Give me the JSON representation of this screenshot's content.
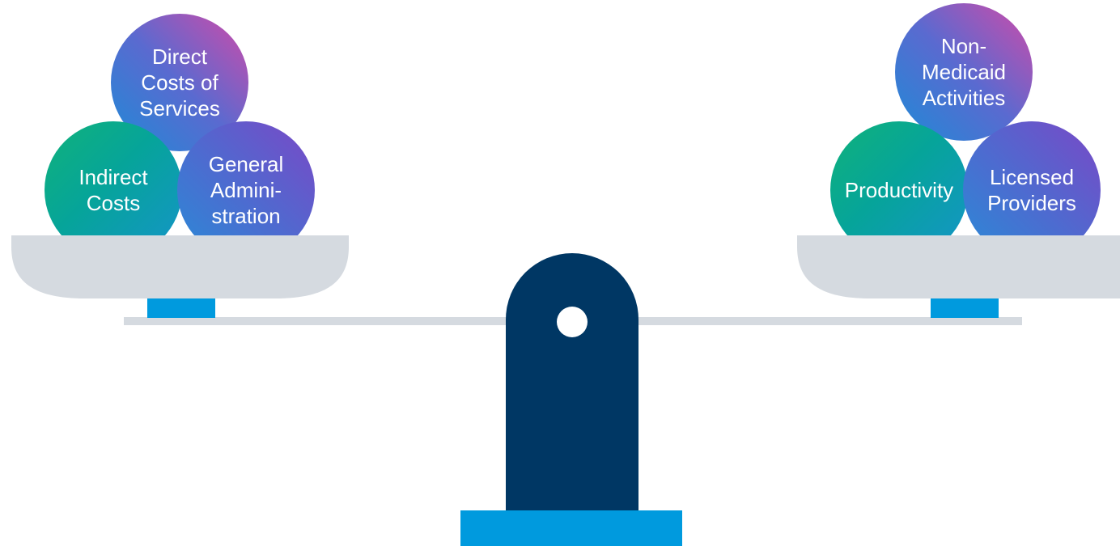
{
  "left_pan": {
    "balls": {
      "direct_costs": "Direct\nCosts of\nServices",
      "indirect_costs": "Indirect\nCosts",
      "general_administration": "General\nAdmini-\nstration"
    }
  },
  "right_pan": {
    "balls": {
      "non_medicaid": "Non-\nMedicaid\nActivities",
      "productivity": "Productivity",
      "licensed_providers": "Licensed\nProviders"
    }
  },
  "colors": {
    "pan": "#d5dae0",
    "beam": "#d5dae0",
    "fulcrum": "#003764",
    "base": "#009ade",
    "pan_connector": "#009ade",
    "pivot_hole": "#ffffff"
  }
}
